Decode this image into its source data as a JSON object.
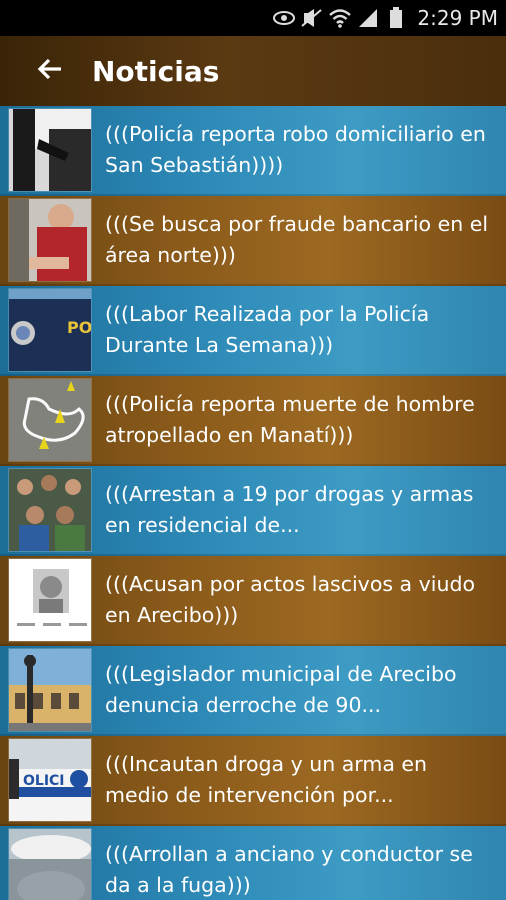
{
  "status_bar": {
    "time": "2:29 PM",
    "icons": [
      "eye-icon",
      "mute-icon",
      "wifi-icon",
      "signal-icon",
      "battery-icon"
    ]
  },
  "app_bar": {
    "title": "Noticias",
    "back_icon": "back-arrow-icon"
  },
  "news": [
    {
      "title": "(((Policía reporta robo domiciliario en San Sebastián))))",
      "theme": "blue"
    },
    {
      "title": "(((Se busca por fraude bancario en el área norte)))",
      "theme": "brown"
    },
    {
      "title": "(((Labor Realizada por la Policía Durante La Semana)))",
      "theme": "blue"
    },
    {
      "title": "(((Policía reporta muerte de hombre atropellado en Manatí)))",
      "theme": "brown"
    },
    {
      "title": "(((Arrestan a 19 por drogas y armas en residencial de...",
      "theme": "blue"
    },
    {
      "title": "(((Acusan por actos lascivos a viudo en Arecibo)))",
      "theme": "brown"
    },
    {
      "title": "(((Legislador municipal de Arecibo denuncia derroche de 90...",
      "theme": "blue"
    },
    {
      "title": "(((Incautan droga y un arma en medio de intervención por...",
      "theme": "brown"
    },
    {
      "title": "(((Arrollan a anciano y conductor se da a la fuga)))",
      "theme": "blue"
    }
  ],
  "colors": {
    "appbar": "#4a2e0c",
    "item_blue": "#2b86b4",
    "item_brown": "#8a5a1a",
    "text": "#ffffff"
  }
}
